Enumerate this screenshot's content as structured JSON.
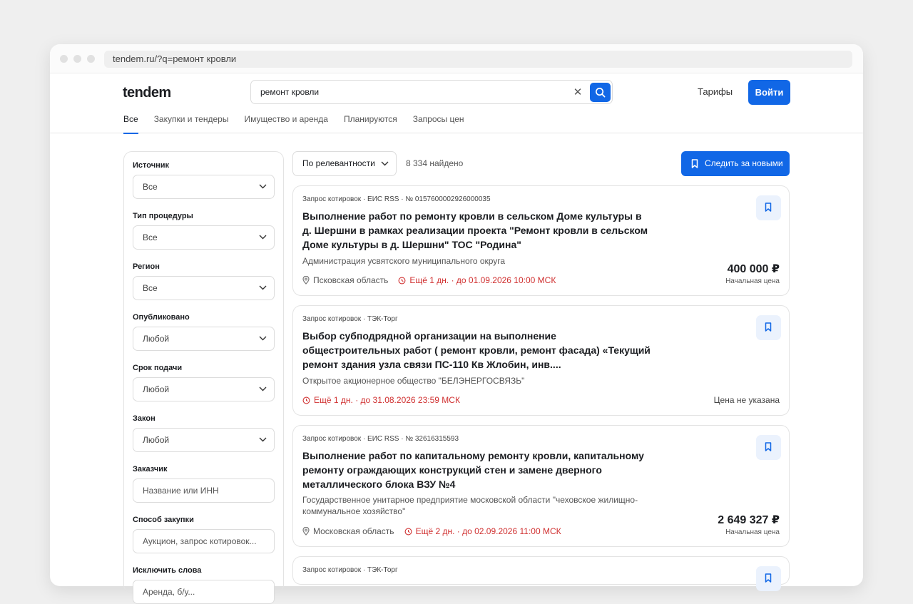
{
  "browser": {
    "url": "tendem.ru/?q=ремонт кровли"
  },
  "header": {
    "logo": "tendem",
    "search_value": "ремонт кровли",
    "clear_symbol": "✕",
    "tariffs": "Тарифы",
    "login": "Войти"
  },
  "tabs": [
    "Все",
    "Закупки и тендеры",
    "Имущество и аренда",
    "Планируются",
    "Запросы цен"
  ],
  "filters": {
    "source": {
      "label": "Источник",
      "value": "Все"
    },
    "procedure": {
      "label": "Тип процедуры",
      "value": "Все"
    },
    "region": {
      "label": "Регион",
      "value": "Все"
    },
    "published": {
      "label": "Опубликовано",
      "value": "Любой"
    },
    "deadline": {
      "label": "Срок подачи",
      "value": "Любой"
    },
    "law": {
      "label": "Закон",
      "value": "Любой"
    },
    "customer": {
      "label": "Заказчик",
      "placeholder": "Название или ИНН"
    },
    "method": {
      "label": "Способ закупки",
      "placeholder": "Аукцион, запрос котировок..."
    },
    "exclude": {
      "label": "Исключить слова",
      "placeholder": "Аренда, б/у..."
    }
  },
  "results": {
    "sort": "По релевантности",
    "found": "8 334 найдено",
    "follow": "Следить за новыми"
  },
  "cards": [
    {
      "meta": "Запрос котировок · ЕИС RSS · № 0157600002926000035",
      "title": "Выполнение работ по ремонту кровли в сельском Доме культуры в д. Шершни в рамках реализации проекта \"Ремонт кровли в сельском Доме культуры в д. Шершни\" ТОС \"Родина\"",
      "org": "Администрация усвятского муниципального округа",
      "location": "Псковская область",
      "deadline": "Ещё 1 дн. · до 01.09.2026 10:00 МСК",
      "price": "400 000 ₽",
      "price_label": "Начальная цена"
    },
    {
      "meta": "Запрос котировок · ТЭК-Торг",
      "title": "Выбор субподрядной организации на выполнение общестроительных работ ( ремонт кровли, ремонт фасада) «Текущий ремонт здания узла связи ПС-110 Кв Жлобин, инв....",
      "org": "Открытое акционерное общество \"БЕЛЭНЕРГОСВЯЗЬ\"",
      "deadline": "Ещё 1 дн. · до 31.08.2026 23:59 МСК",
      "no_price": "Цена не указана"
    },
    {
      "meta": "Запрос котировок · ЕИС RSS · № 32616315593",
      "title": "Выполнение работ по капитальному ремонту кровли, капитальному ремонту ограждающих конструкций стен и замене дверного металлического блока ВЗУ №4",
      "org": "Государственное унитарное предприятие московской области \"чеховское жилищно-коммунальное хозяйство\"",
      "location": "Московская область",
      "deadline": "Ещё 2 дн. · до 02.09.2026 11:00 МСК",
      "price": "2 649 327 ₽",
      "price_label": "Начальная цена"
    },
    {
      "meta": "Запрос котировок · ТЭК-Торг"
    }
  ]
}
